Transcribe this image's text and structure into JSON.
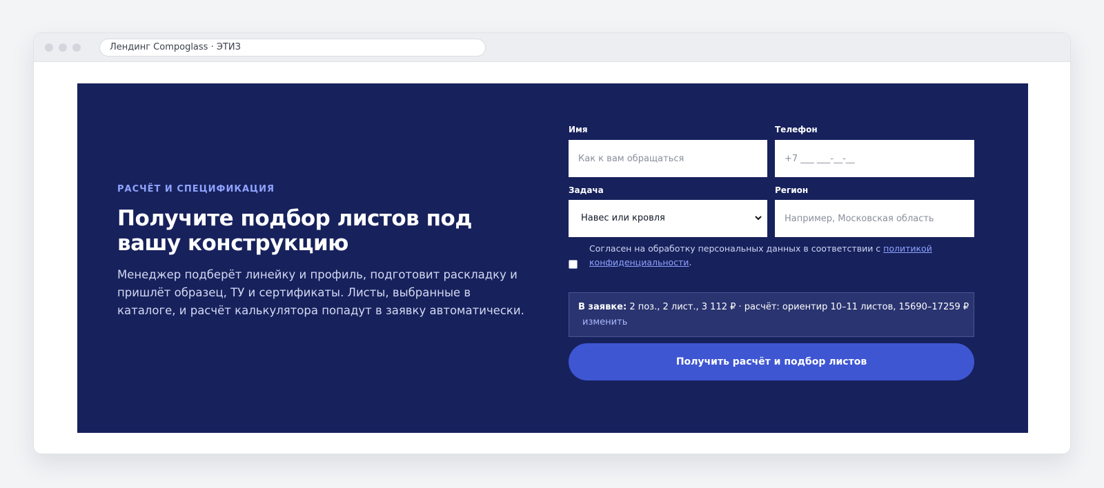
{
  "browser": {
    "tab_title": "Лендинг Compoglass · ЭТИЗ"
  },
  "hero": {
    "eyebrow": "РАСЧЁТ И СПЕЦИФИКАЦИЯ",
    "title": "Получите подбор листов под вашу конструкцию",
    "lead": "Менеджер подберёт линейку и профиль, подготовит раскладку и пришлёт образец, ТУ и сертификаты. Листы, выбранные в каталоге, и расчёт калькулятора попадут в заявку автоматически."
  },
  "form": {
    "name": {
      "label": "Имя",
      "placeholder": "Как к вам обращаться"
    },
    "phone": {
      "label": "Телефон",
      "placeholder": "+7 ___ ___-__-__"
    },
    "task": {
      "label": "Задача",
      "selected": "Навес или кровля"
    },
    "region": {
      "label": "Регион",
      "placeholder": "Например, Московская область"
    },
    "consent": {
      "text": "Согласен на обработку персональных данных в соответствии с ",
      "link": "политикой конфиденциальности",
      "suffix": "."
    },
    "summary": {
      "label": "В заявке:",
      "text": " 2 поз., 2 лист., 3 112 ₽ · расчёт: ориентир 10–11 листов, 15690–17259 ₽",
      "change": "изменить"
    },
    "submit": "Получить расчёт и подбор листов"
  },
  "colors": {
    "hero_bg": "#17215c",
    "accent": "#3e56d2",
    "eyebrow": "#8fa3ff"
  },
  "icons": {
    "select_chevron": "chevron-down-icon"
  }
}
